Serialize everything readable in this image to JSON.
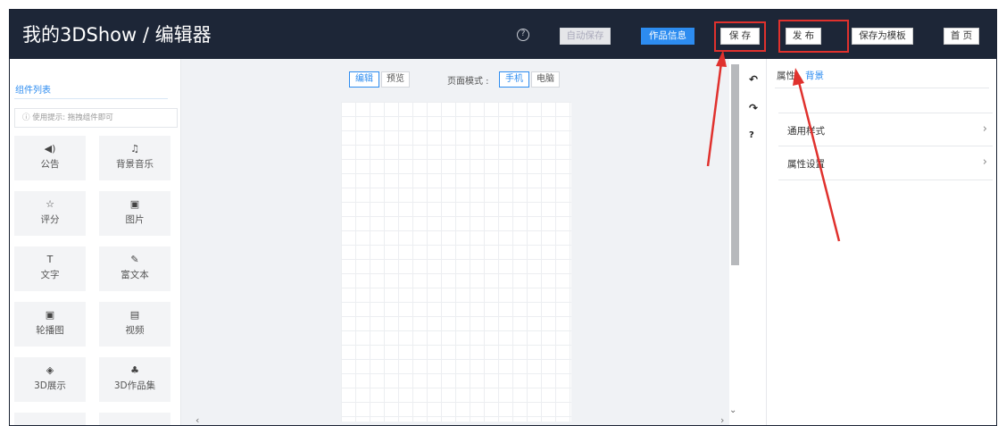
{
  "header": {
    "title": "我的3DShow / 编辑器",
    "help_glyph": "?",
    "buttons": {
      "autosave": "自动保存",
      "work_info": "作品信息",
      "save": "保 存",
      "publish": "发 布",
      "save_template": "保存为模板",
      "home": "首 页"
    }
  },
  "left_panel": {
    "title": "组件列表",
    "hint": "ⓘ 使用提示: 拖拽组件即可",
    "components": [
      {
        "icon": "◀)",
        "icon_name": "speaker-icon",
        "label": "公告"
      },
      {
        "icon": "♫",
        "icon_name": "music-note-icon",
        "label": "背景音乐"
      },
      {
        "icon": "☆",
        "icon_name": "star-icon",
        "label": "评分"
      },
      {
        "icon": "▣",
        "icon_name": "image-icon",
        "label": "图片"
      },
      {
        "icon": "T",
        "icon_name": "text-icon",
        "label": "文字"
      },
      {
        "icon": "✎",
        "icon_name": "edit-icon",
        "label": "富文本"
      },
      {
        "icon": "▣",
        "icon_name": "carousel-image-icon",
        "label": "轮播图"
      },
      {
        "icon": "▤",
        "icon_name": "video-file-icon",
        "label": "视频"
      },
      {
        "icon": "◈",
        "icon_name": "cube-icon",
        "label": "3D展示"
      },
      {
        "icon": "♣",
        "icon_name": "cubes-icon",
        "label": "3D作品集"
      }
    ]
  },
  "canvas": {
    "tabs": {
      "edit": "编辑",
      "preview": "预览"
    },
    "mode_label": "页面模式 :",
    "modes": {
      "phone": "手机",
      "pc": "电脑"
    },
    "scroll_left": "‹",
    "scroll_right": "›",
    "scroll_down": "⌄"
  },
  "tools": {
    "undo": "↶",
    "redo": "↷",
    "help": "?"
  },
  "right_panel": {
    "tabs": {
      "props": "属性",
      "background": "背景"
    },
    "sections": [
      {
        "label": "通用样式",
        "chevron": "›"
      },
      {
        "label": "属性设置",
        "chevron": "›"
      }
    ]
  },
  "colors": {
    "topbar": "#1d2637",
    "accent": "#2d8cf0",
    "annotation": "#e0312d"
  }
}
